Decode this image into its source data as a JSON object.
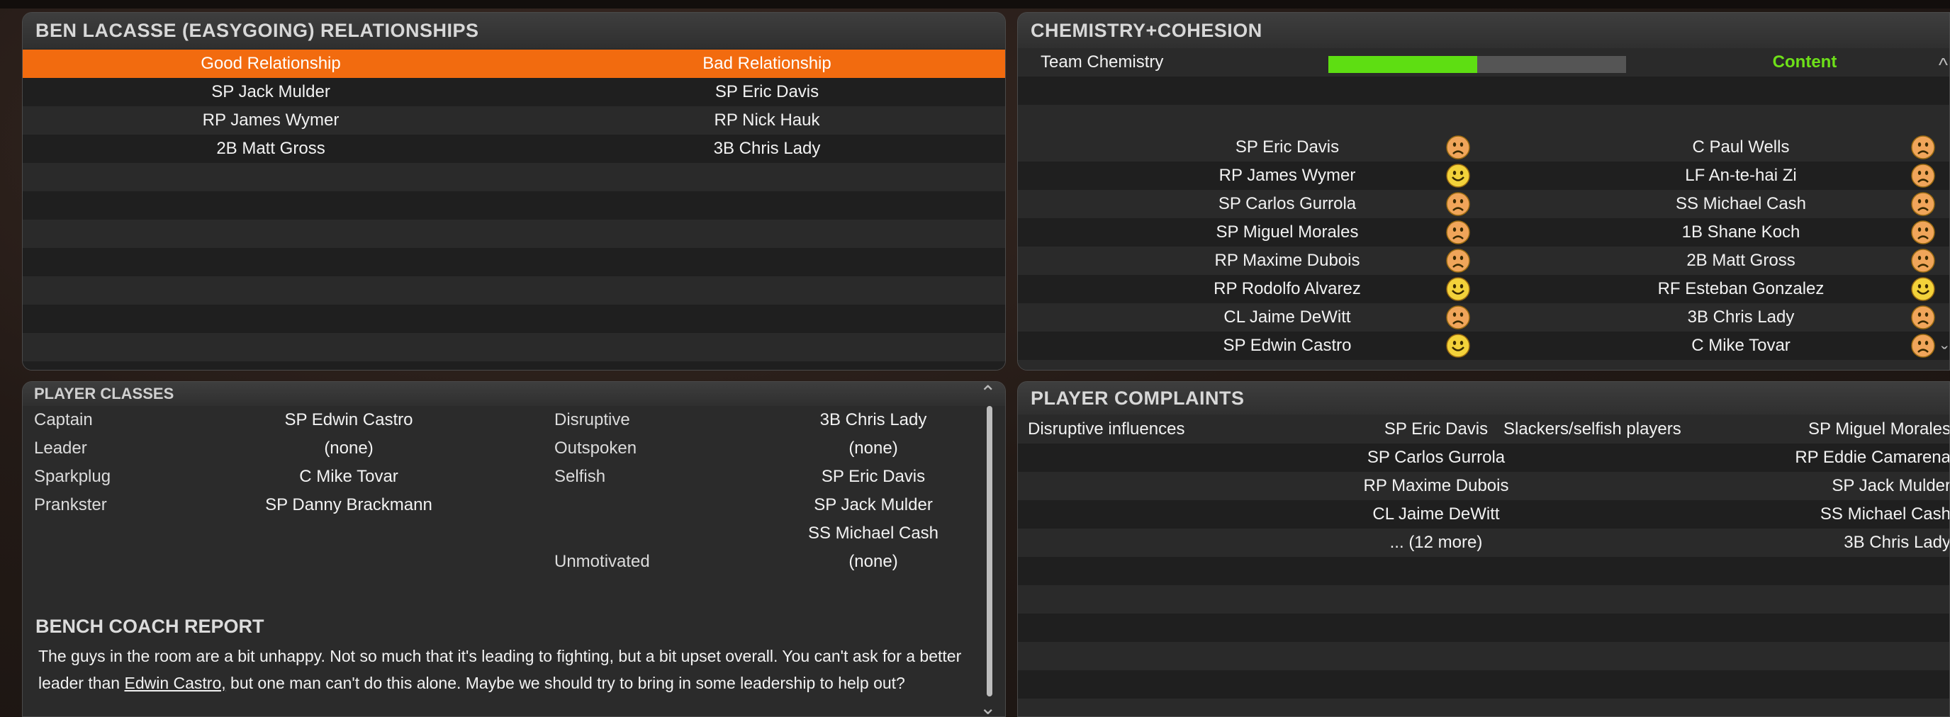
{
  "relationships": {
    "title": "BEN LACASSE (EASYGOING) RELATIONSHIPS",
    "good_header": "Good Relationship",
    "bad_header": "Bad Relationship",
    "rows": [
      {
        "good": "SP Jack Mulder",
        "bad": "SP Eric Davis"
      },
      {
        "good": "RP James Wymer",
        "bad": "RP Nick Hauk"
      },
      {
        "good": "2B Matt Gross",
        "bad": "3B Chris Lady"
      }
    ]
  },
  "chemistry": {
    "title": "CHEMISTRY+COHESION",
    "team_chemistry_label": "Team Chemistry",
    "team_chemistry_value": 0.5,
    "status": "Content",
    "status_color": "#6ee019",
    "bar_color": "#5ede12",
    "players_left": [
      {
        "name": "SP Eric Davis",
        "mood": "sad"
      },
      {
        "name": "RP James Wymer",
        "mood": "happy"
      },
      {
        "name": "SP Carlos Gurrola",
        "mood": "sad"
      },
      {
        "name": "SP Miguel Morales",
        "mood": "sad"
      },
      {
        "name": "RP Maxime Dubois",
        "mood": "sad"
      },
      {
        "name": "RP Rodolfo Alvarez",
        "mood": "happy"
      },
      {
        "name": "CL Jaime DeWitt",
        "mood": "sad"
      },
      {
        "name": "SP Edwin Castro",
        "mood": "happy"
      }
    ],
    "players_right": [
      {
        "name": "C Paul Wells",
        "mood": "sad"
      },
      {
        "name": "LF An-te-hai Zi",
        "mood": "sad"
      },
      {
        "name": "SS Michael Cash",
        "mood": "sad"
      },
      {
        "name": "1B Shane Koch",
        "mood": "sad"
      },
      {
        "name": "2B Matt Gross",
        "mood": "sad"
      },
      {
        "name": "RF Esteban Gonzalez",
        "mood": "happy"
      },
      {
        "name": "3B Chris Lady",
        "mood": "sad"
      },
      {
        "name": "C Mike Tovar",
        "mood": "sad"
      }
    ]
  },
  "player_classes": {
    "title": "PLAYER CLASSES",
    "left": [
      {
        "label": "Captain",
        "value": "SP Edwin Castro"
      },
      {
        "label": "Leader",
        "value": "(none)"
      },
      {
        "label": "Sparkplug",
        "value": "C Mike Tovar"
      },
      {
        "label": "Prankster",
        "value": "SP Danny Brackmann"
      }
    ],
    "right": [
      {
        "label": "Disruptive",
        "value": "3B Chris Lady"
      },
      {
        "label": "Outspoken",
        "value": "(none)"
      },
      {
        "label": "Selfish",
        "value": "SP Eric Davis"
      },
      {
        "label": "",
        "value": "SP Jack Mulder"
      },
      {
        "label": "",
        "value": "SS Michael Cash"
      },
      {
        "label": "Unmotivated",
        "value": "(none)"
      }
    ]
  },
  "bench_coach": {
    "title": "BENCH COACH REPORT",
    "text_before": "The guys in the room are a bit unhappy. Not so much that it's leading to fighting, but a bit upset overall. You can't ask for a better leader than ",
    "link": "Edwin Castro,",
    "text_after": " but one man can't do this alone. Maybe we should try to bring in some leadership to help out?"
  },
  "complaints": {
    "title": "PLAYER COMPLAINTS",
    "disruptive_label": "Disruptive influences",
    "slackers_label": "Slackers/selfish players",
    "disruptive": [
      "SP Eric Davis",
      "SP Carlos Gurrola",
      "RP Maxime Dubois",
      "CL Jaime DeWitt",
      "... (12 more)"
    ],
    "slackers": [
      "SP Miguel Morales",
      "RP Eddie Camarena",
      "SP Jack Mulder",
      "SS Michael Cash",
      "3B Chris Lady"
    ]
  }
}
